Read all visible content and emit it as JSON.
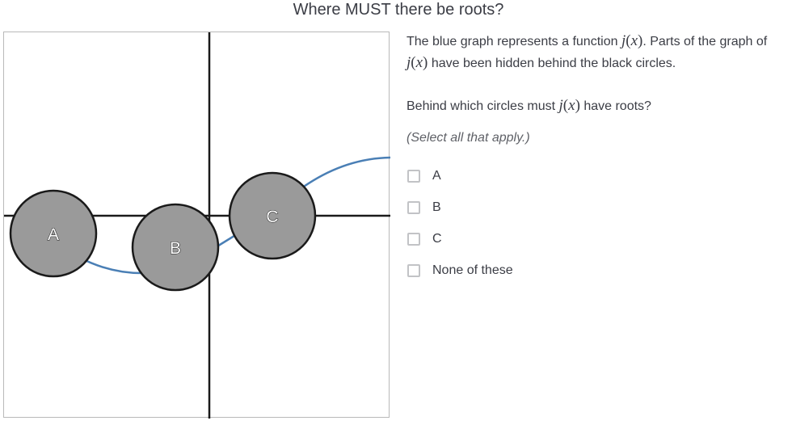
{
  "title": "Where MUST there be roots?",
  "description": {
    "part1": "The blue graph represents a function ",
    "func": "j",
    "var": "x",
    "part2": ". Parts of the graph of",
    "part3": " have been hidden behind the black circles."
  },
  "question": {
    "part1": "Behind which circles must ",
    "part2": " have roots?"
  },
  "hint": "(Select all that apply.)",
  "choices": [
    {
      "label": "A",
      "checked": false
    },
    {
      "label": "B",
      "checked": false
    },
    {
      "label": "C",
      "checked": false
    },
    {
      "label": "None of these",
      "checked": false
    }
  ],
  "graph": {
    "curve_color": "#4a7fb5",
    "circle_fill": "#9a9a9a",
    "circle_stroke": "#1a1a1a",
    "axis_color": "#1a1a1a",
    "circles": [
      {
        "label": "A"
      },
      {
        "label": "B"
      },
      {
        "label": "C"
      }
    ]
  }
}
